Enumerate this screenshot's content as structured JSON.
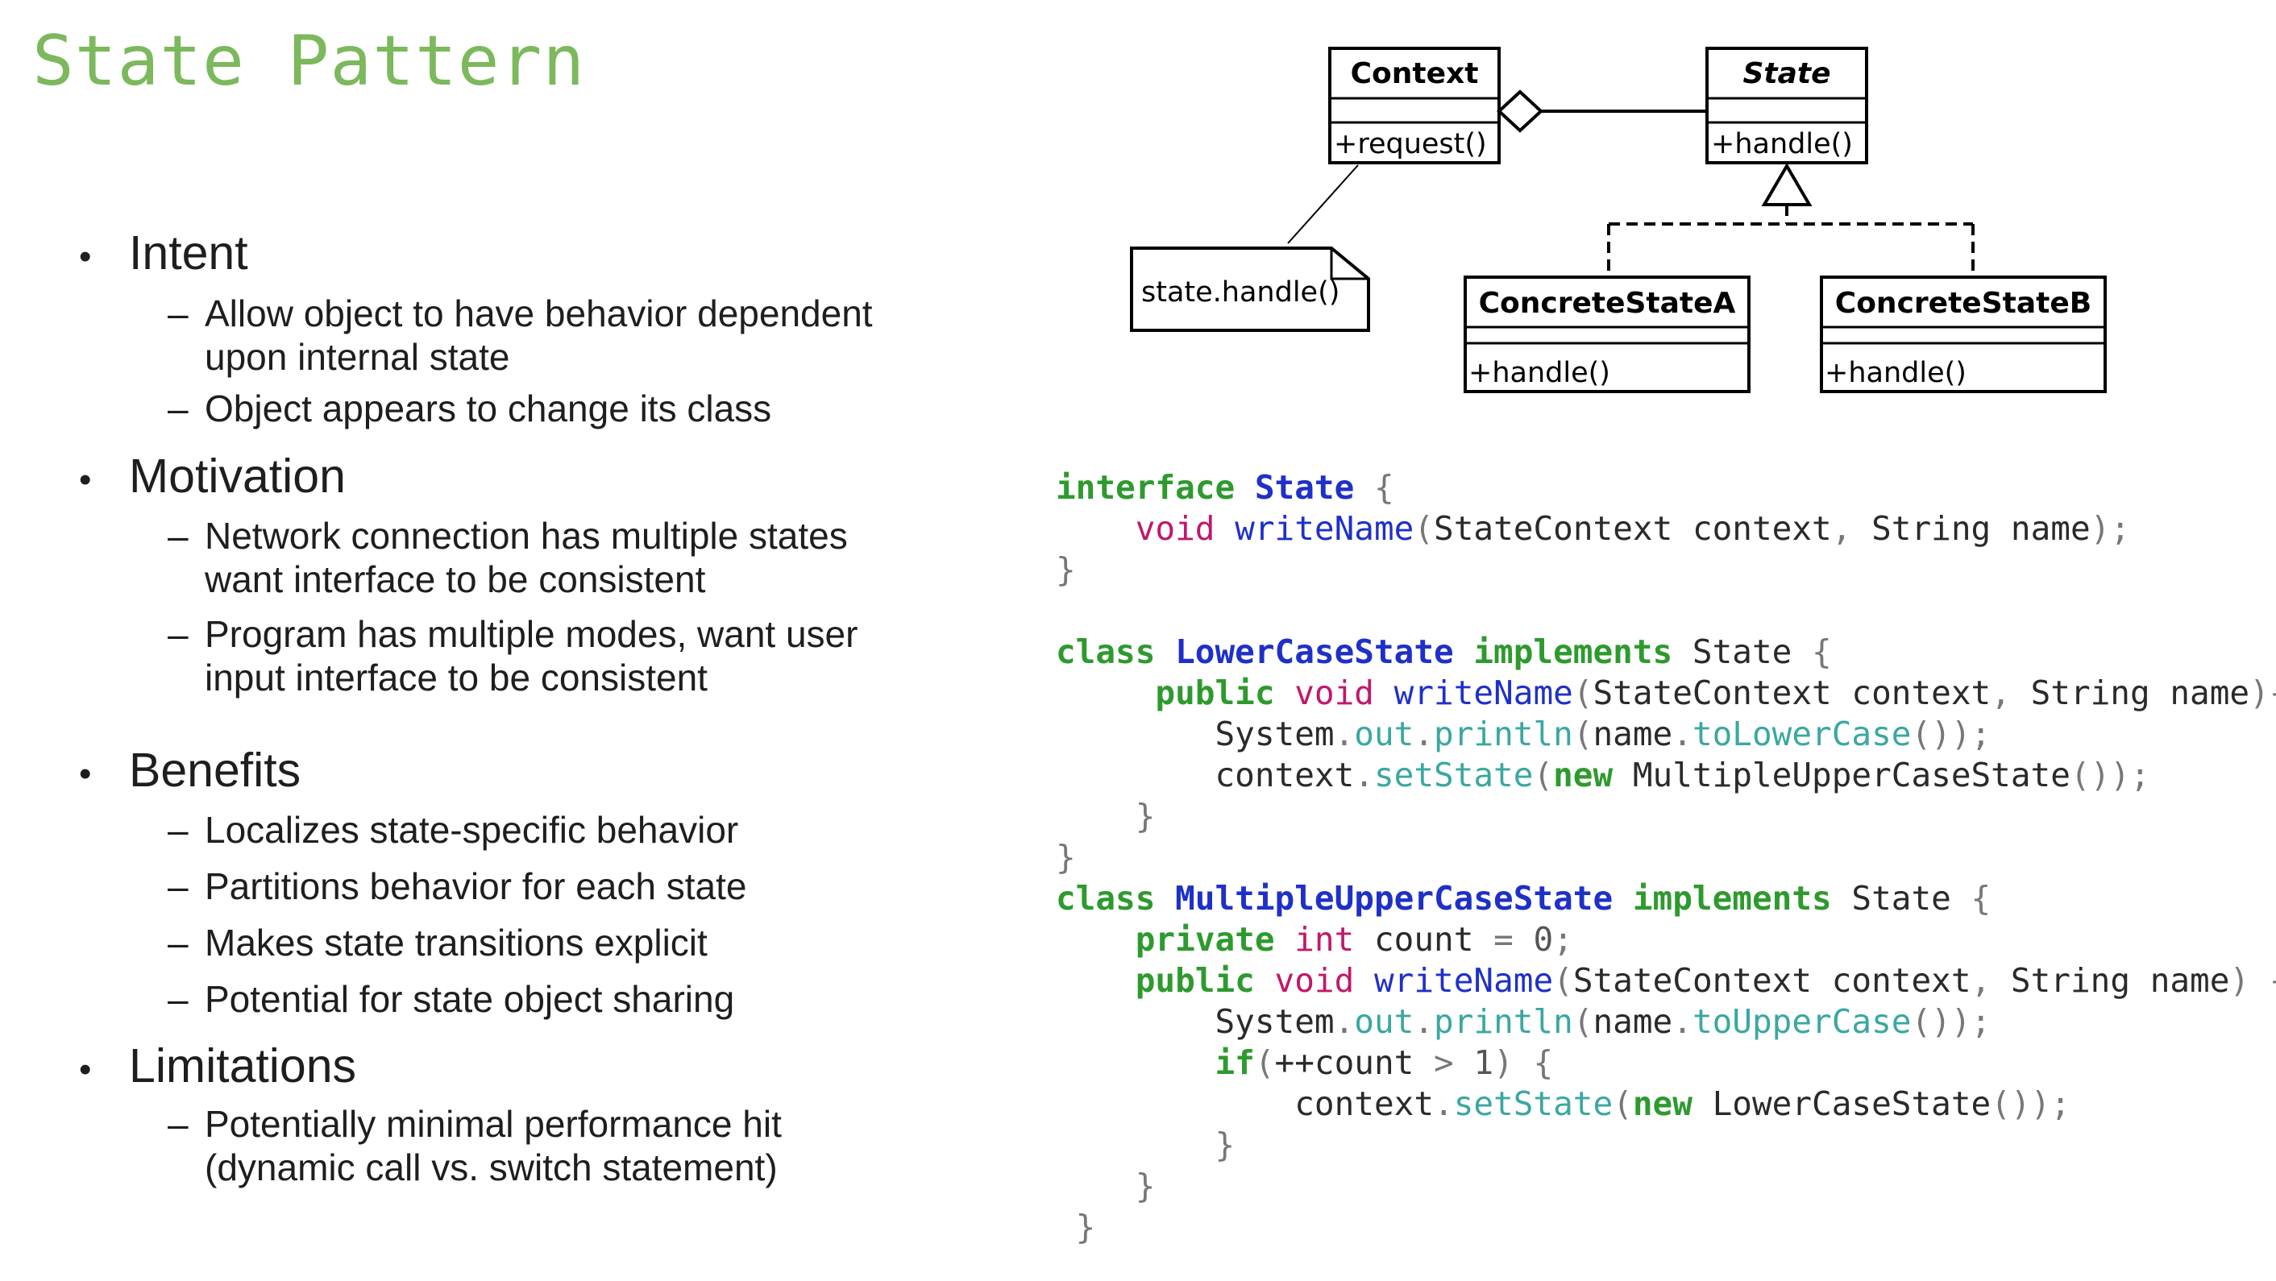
{
  "title": "State Pattern",
  "theme": {
    "title_color": "#7cb85c",
    "text_color": "#1e1e1e",
    "keyword_color": "#2e9a2e",
    "type_color": "#c0186a",
    "name_color": "#1f30c8",
    "field_color": "#3aa8a0"
  },
  "bullet_glyph": "•",
  "dash_glyph": "–",
  "sections": [
    {
      "label": "Intent",
      "items": [
        [
          "Allow object to have behavior dependent",
          "upon internal state"
        ],
        [
          "Object appears to change its class"
        ]
      ]
    },
    {
      "label": "Motivation",
      "items": [
        [
          "Network connection has multiple states",
          "want interface to be consistent"
        ],
        [
          "Program has multiple modes, want user",
          "input interface to be consistent"
        ]
      ]
    },
    {
      "label": "Benefits",
      "items": [
        [
          "Localizes state-specific behavior"
        ],
        [
          "Partitions behavior for each state"
        ],
        [
          "Makes state transitions explicit"
        ],
        [
          "Potential for state object sharing"
        ]
      ]
    },
    {
      "label": "Limitations",
      "items": [
        [
          "Potentially minimal performance hit",
          "(dynamic call vs. switch statement)"
        ]
      ]
    }
  ],
  "uml": {
    "context": {
      "name": "Context",
      "method": "+request()"
    },
    "state": {
      "name": "State",
      "method": "+handle()"
    },
    "note": "state.handle()",
    "concrete_a": {
      "name": "ConcreteStateA",
      "method": "+handle()"
    },
    "concrete_b": {
      "name": "ConcreteStateB",
      "method": "+handle()"
    }
  },
  "code": [
    [
      [
        "kw",
        "interface"
      ],
      [
        "plain",
        " "
      ],
      [
        "name",
        "State"
      ],
      [
        "punc",
        " {"
      ]
    ],
    [
      [
        "plain",
        "    "
      ],
      [
        "type",
        "void"
      ],
      [
        "plain",
        " "
      ],
      [
        "method",
        "writeName"
      ],
      [
        "punc",
        "("
      ],
      [
        "plain",
        "StateContext context"
      ],
      [
        "punc",
        ","
      ],
      [
        "plain",
        " String name"
      ],
      [
        "punc",
        ");"
      ]
    ],
    [
      [
        "punc",
        "}"
      ]
    ],
    [],
    [
      [
        "kw",
        "class"
      ],
      [
        "plain",
        " "
      ],
      [
        "name",
        "LowerCaseState"
      ],
      [
        "plain",
        " "
      ],
      [
        "kw",
        "implements"
      ],
      [
        "plain",
        " State "
      ],
      [
        "punc",
        "{"
      ]
    ],
    [
      [
        "plain",
        "     "
      ],
      [
        "kw",
        "public"
      ],
      [
        "plain",
        " "
      ],
      [
        "type",
        "void"
      ],
      [
        "plain",
        " "
      ],
      [
        "method",
        "writeName"
      ],
      [
        "punc",
        "("
      ],
      [
        "plain",
        "StateContext context"
      ],
      [
        "punc",
        ","
      ],
      [
        "plain",
        " String name"
      ],
      [
        "punc",
        "){"
      ]
    ],
    [
      [
        "plain",
        "        System"
      ],
      [
        "punc",
        "."
      ],
      [
        "field",
        "out"
      ],
      [
        "punc",
        "."
      ],
      [
        "field",
        "println"
      ],
      [
        "punc",
        "("
      ],
      [
        "plain",
        "name"
      ],
      [
        "punc",
        "."
      ],
      [
        "field",
        "toLowerCase"
      ],
      [
        "punc",
        "());"
      ]
    ],
    [
      [
        "plain",
        "        context"
      ],
      [
        "punc",
        "."
      ],
      [
        "field",
        "setState"
      ],
      [
        "punc",
        "("
      ],
      [
        "kw",
        "new"
      ],
      [
        "plain",
        " MultipleUpperCaseState"
      ],
      [
        "punc",
        "());"
      ]
    ],
    [
      [
        "punc",
        "    }"
      ]
    ],
    [
      [
        "punc",
        "}"
      ]
    ],
    [
      [
        "kw",
        "class"
      ],
      [
        "plain",
        " "
      ],
      [
        "name",
        "MultipleUpperCaseState"
      ],
      [
        "plain",
        " "
      ],
      [
        "kw",
        "implements"
      ],
      [
        "plain",
        " State "
      ],
      [
        "punc",
        "{"
      ]
    ],
    [
      [
        "plain",
        "    "
      ],
      [
        "kw",
        "private"
      ],
      [
        "plain",
        " "
      ],
      [
        "type",
        "int"
      ],
      [
        "plain",
        " count "
      ],
      [
        "punc",
        "="
      ],
      [
        "num",
        " 0"
      ],
      [
        "punc",
        ";"
      ]
    ],
    [
      [
        "plain",
        "    "
      ],
      [
        "kw",
        "public"
      ],
      [
        "plain",
        " "
      ],
      [
        "type",
        "void"
      ],
      [
        "plain",
        " "
      ],
      [
        "method",
        "writeName"
      ],
      [
        "punc",
        "("
      ],
      [
        "plain",
        "StateContext context"
      ],
      [
        "punc",
        ","
      ],
      [
        "plain",
        " String name"
      ],
      [
        "punc",
        ") {"
      ]
    ],
    [
      [
        "plain",
        "        System"
      ],
      [
        "punc",
        "."
      ],
      [
        "field",
        "out"
      ],
      [
        "punc",
        "."
      ],
      [
        "field",
        "println"
      ],
      [
        "punc",
        "("
      ],
      [
        "plain",
        "name"
      ],
      [
        "punc",
        "."
      ],
      [
        "field",
        "toUpperCase"
      ],
      [
        "punc",
        "());"
      ]
    ],
    [
      [
        "plain",
        "        "
      ],
      [
        "kw",
        "if"
      ],
      [
        "punc",
        "("
      ],
      [
        "plain",
        "++count "
      ],
      [
        "punc",
        ">"
      ],
      [
        "num",
        " 1"
      ],
      [
        "punc",
        ") {"
      ]
    ],
    [
      [
        "plain",
        "            context"
      ],
      [
        "punc",
        "."
      ],
      [
        "field",
        "setState"
      ],
      [
        "punc",
        "("
      ],
      [
        "kw",
        "new"
      ],
      [
        "plain",
        " LowerCaseState"
      ],
      [
        "punc",
        "());"
      ]
    ],
    [
      [
        "punc",
        "        }"
      ]
    ],
    [
      [
        "punc",
        "    }"
      ]
    ],
    [
      [
        "punc",
        " }"
      ]
    ]
  ]
}
